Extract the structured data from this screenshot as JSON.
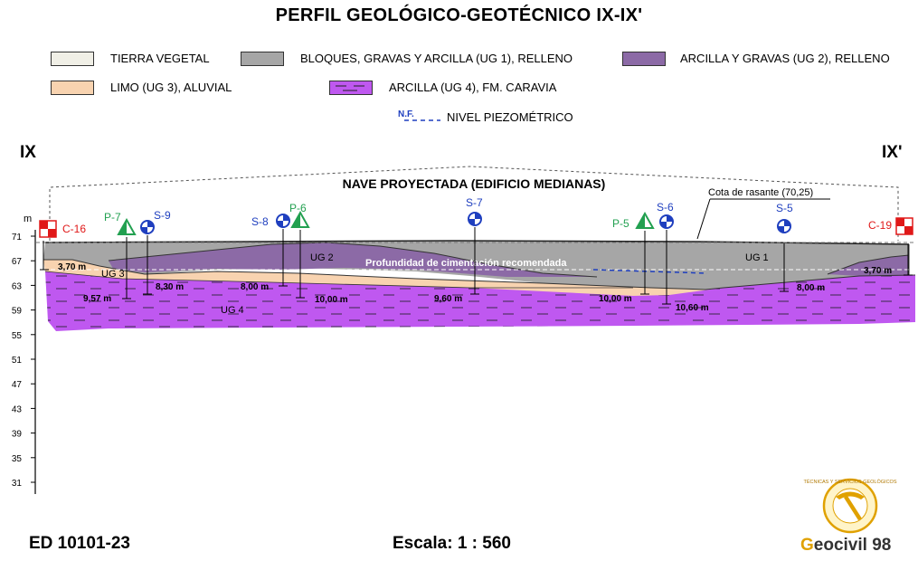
{
  "title": "PERFIL GEOLÓGICO-GEOTÉCNICO IX-IX'",
  "legend": {
    "tierra_vegetal": "TIERRA VEGETAL",
    "ug1": "BLOQUES, GRAVAS Y ARCILLA (UG 1), RELLENO",
    "ug2": "ARCILLA Y GRAVAS (UG 2), RELLENO",
    "ug3": "LIMO (UG 3), ALUVIAL",
    "ug4": "ARCILLA (UG 4), FM. CARAVIA",
    "nf_symbol": "N.F.",
    "nf_label": "NIVEL PIEZOMÉTRICO"
  },
  "colors": {
    "tierra_vegetal": "#f0efe6",
    "ug1": "#a6a6a6",
    "ug2": "#8c6aa6",
    "ug3": "#f8d3b0",
    "ug4": "#bf58f0",
    "sondeo": "#1f3fbf",
    "penetro": "#22a050",
    "calicata": "#e01818"
  },
  "section": {
    "start": "IX",
    "end": "IX'"
  },
  "axis": {
    "unit": "m",
    "ticks": [
      "71",
      "67",
      "63",
      "59",
      "55",
      "51",
      "47",
      "43",
      "39",
      "35",
      "31"
    ]
  },
  "labels": {
    "nave": "NAVE PROYECTADA (EDIFICIO MEDIANAS)",
    "rasante": "Cota de rasante (70,25)",
    "cimentacion": "Profundidad de cimentación recomendada",
    "ug1": "UG 1",
    "ug2": "UG 2",
    "ug3": "UG 3",
    "ug4": "UG 4"
  },
  "points": {
    "c16": "C-16",
    "p7": "P-7",
    "s9": "S-9",
    "s8": "S-8",
    "p6": "P-6",
    "s7": "S-7",
    "p5": "P-5",
    "s6": "S-6",
    "s5": "S-5",
    "c19": "C-19"
  },
  "depths": {
    "c16": "3,70 m",
    "p7": "9,57 m",
    "s9": "8,30 m",
    "s8": "8,00 m",
    "p6": "10,00 m",
    "s7": "9,60 m",
    "p5": "10,00 m",
    "s6": "10,60 m",
    "s5": "8,00 m",
    "c19": "3,70 m"
  },
  "footer": {
    "code": "ED 10101-23",
    "scale": "Escala: 1 : 560",
    "brand_initial": "G",
    "brand_rest": "eocivil 98",
    "seal_text": "TÉCNICAS Y SERVICIOS GEOLÓGICOS"
  }
}
